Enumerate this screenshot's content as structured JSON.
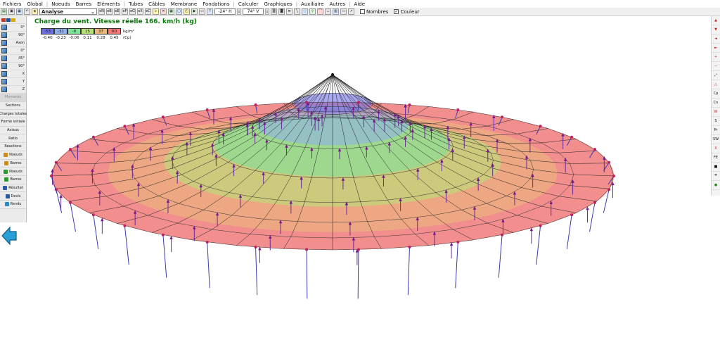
{
  "menu": [
    "Fichiers",
    "Global",
    "Noeuds",
    "Barres",
    "Eléments",
    "Tubes",
    "Câbles",
    "Membrane",
    "Fondations",
    "Calculer",
    "Graphiques",
    "Auxiliaire",
    "Autres",
    "Aide"
  ],
  "toolbar": {
    "mode": "Analyse",
    "view_h": "-24° H",
    "view_v": "74° V",
    "nombres_label": "Nombres",
    "nombres_checked": false,
    "couleur_label": "Couleur",
    "couleur_checked": true,
    "small_buttons": [
      "eN",
      "eB",
      "eE",
      "eP",
      "eG",
      "eX",
      "eC"
    ]
  },
  "left_panel": {
    "view_rows": [
      {
        "label": "0°",
        "icon": "cube-front-icon"
      },
      {
        "label": "90°",
        "icon": "cube-side-icon"
      },
      {
        "label": "Axon",
        "icon": "axonometric-icon"
      },
      {
        "label": "0°",
        "icon": "cube-top-icon"
      },
      {
        "label": "45°",
        "icon": "cube-45-icon"
      },
      {
        "label": "90°",
        "icon": "cube-90-icon"
      },
      {
        "label": "X",
        "icon": "axis-x-icon"
      },
      {
        "label": "Y",
        "icon": "axis-y-icon"
      },
      {
        "label": "Z",
        "icon": "axis-z-icon"
      }
    ],
    "buttons": [
      {
        "label": "Moments",
        "disabled": true,
        "icon": ""
      },
      {
        "label": "Sections",
        "icon": ""
      },
      {
        "label": "Charges totales",
        "icon": ""
      },
      {
        "label": "Forme initiale",
        "icon": ""
      },
      {
        "label": "Axiaux",
        "icon": ""
      },
      {
        "label": "Ratio",
        "icon": ""
      },
      {
        "label": "Réactions",
        "icon": ""
      },
      {
        "label": "Noeuds",
        "icon": "pencil-icon"
      },
      {
        "label": "Barres",
        "icon": "pencil-icon"
      },
      {
        "label": "Noeuds",
        "icon": "plus-icon"
      },
      {
        "label": "Barres",
        "icon": "plus-icon"
      },
      {
        "label": "Résultat",
        "icon": "table-icon"
      },
      {
        "label": "Devis",
        "icon": "document-icon"
      },
      {
        "label": "Rendu",
        "icon": "render-icon"
      }
    ]
  },
  "right_panel": [
    "▲",
    "▼",
    "◄",
    "►",
    "+",
    "−",
    "⤢",
    "△",
    "Cp",
    "Cn",
    "W",
    "S",
    "Pr",
    "SW",
    "X",
    "FE",
    "■",
    "☂",
    "●"
  ],
  "chart": {
    "title": "Charge du vent. Vitesse réelle 166. km/h  (kg)",
    "legend_values": [
      "-53",
      "-31",
      "-8",
      "15",
      "37",
      "60"
    ],
    "legend_cp": [
      "-0.40",
      "-0.23",
      "-0.06",
      "0.11",
      "0.28",
      "0.45"
    ],
    "legend_unit": "kg/m²",
    "legend_cp_unit": "(Cp)",
    "legend_colors": [
      "#6f6fe6",
      "#8fb0e8",
      "#7fe39a",
      "#b8e07a",
      "#e9b87a",
      "#f07a7a"
    ]
  }
}
